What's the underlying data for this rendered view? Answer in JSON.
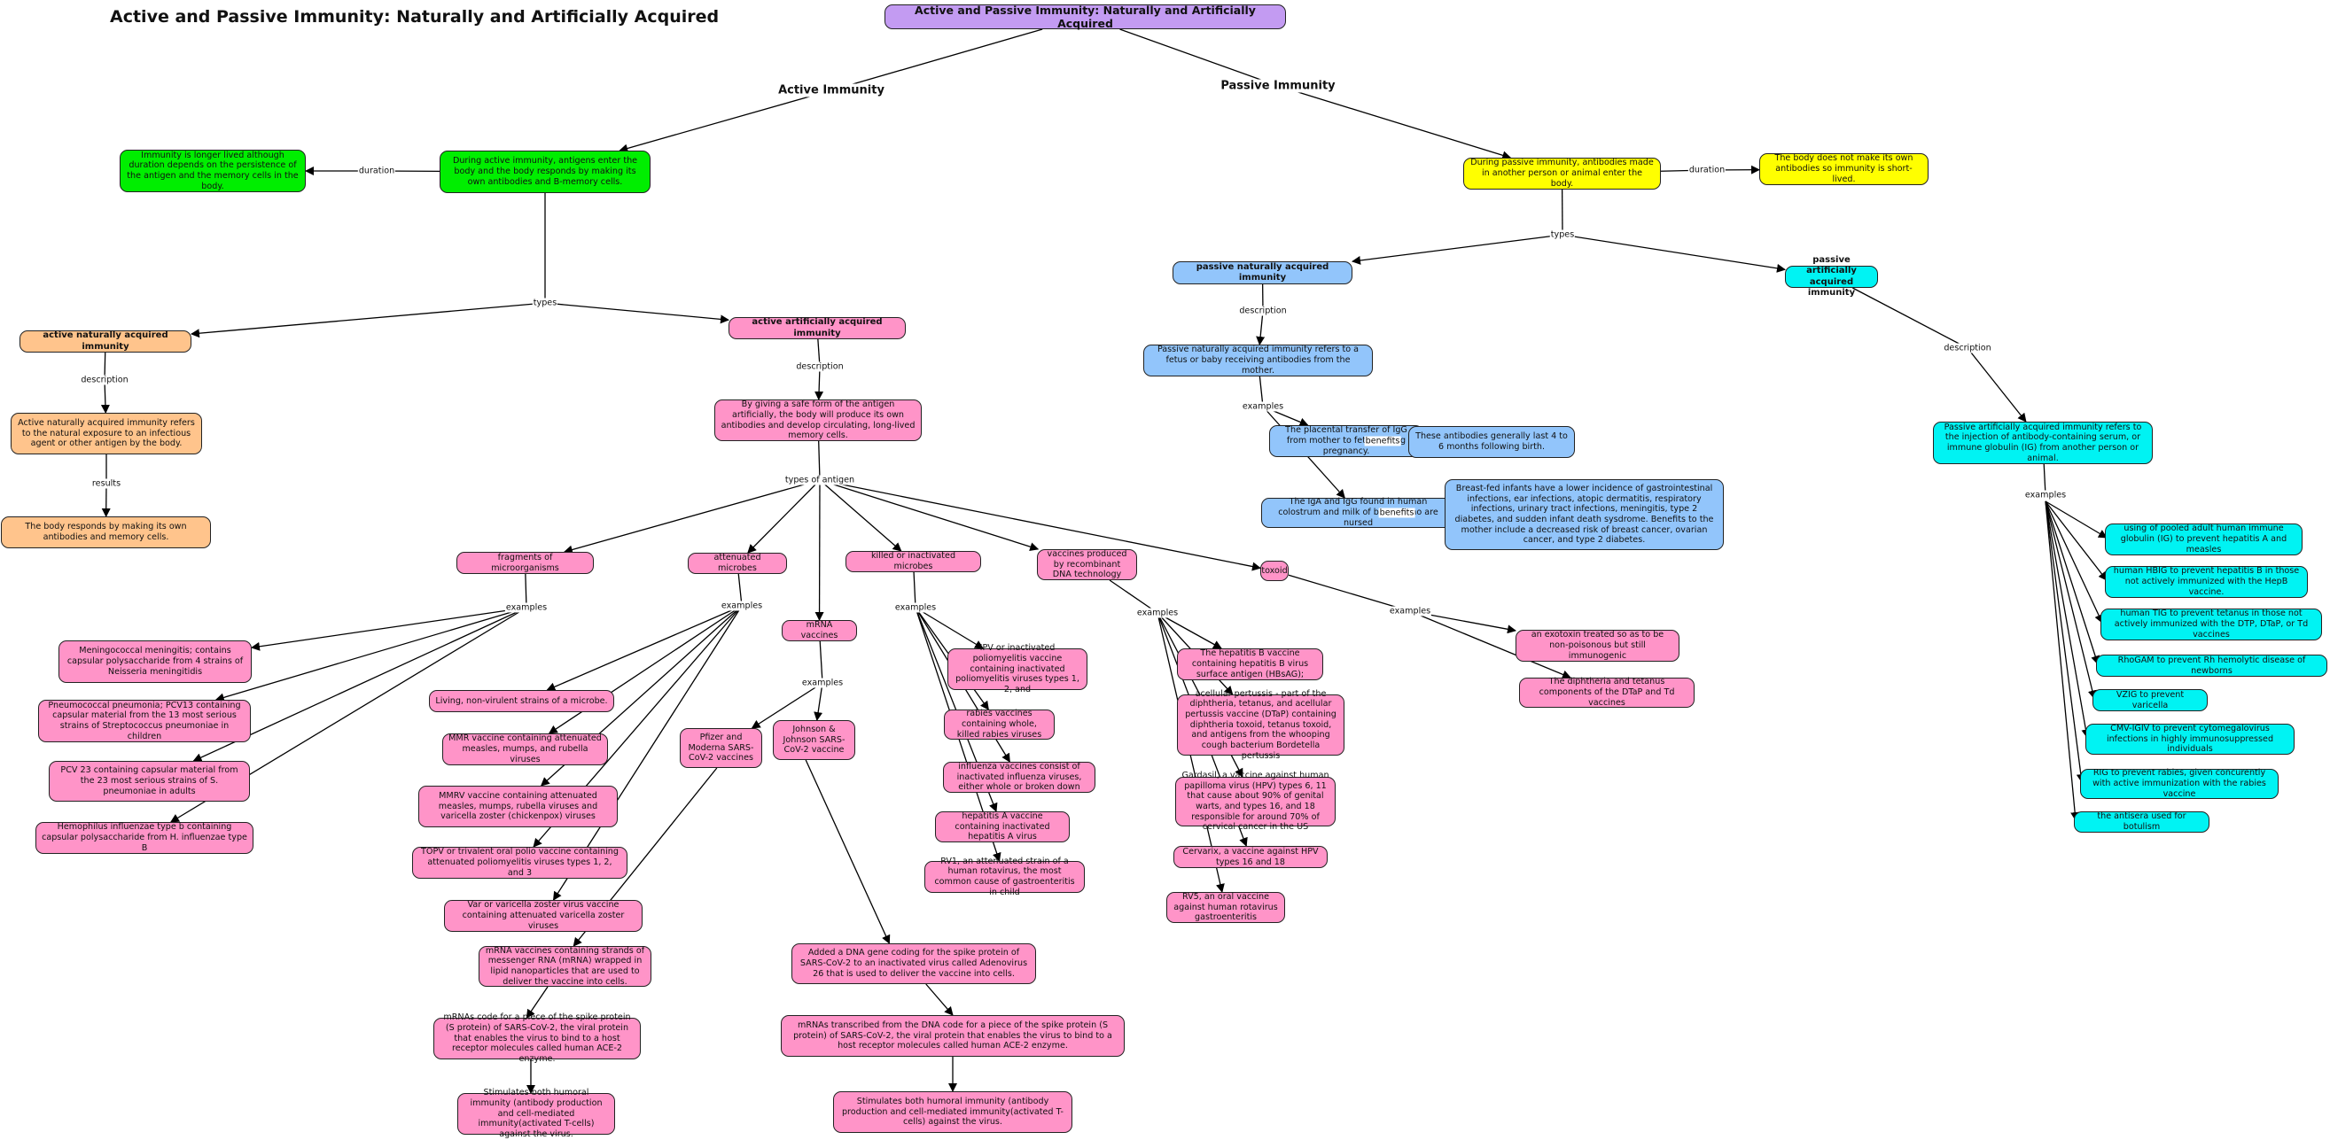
{
  "title": "Active and Passive Immunity: Naturally and Artificially Acquired",
  "colors": {
    "root": "#c39bf2",
    "active": "#00ee00",
    "passive": "#ffff00",
    "active_natural": "#ffc48c",
    "active_artificial": "#ff94c8",
    "passive_natural": "#92c5fb",
    "passive_artificial": "#00f3f3"
  },
  "nodes": {
    "root": "Active and Passive Immunity: Naturally and Artificially Acquired",
    "active_desc": "During active immunity, antigens enter the body and the body responds by making its own antibodies and B-memory cells.",
    "active_duration": "Immunity is longer lived although duration depends on the persistence of the antigen and the memory cells in the body.",
    "passive_desc": "During passive immunity, antibodies made in another person or animal enter the body.",
    "passive_duration": "The body does not make its own antibodies so immunity is short-lived.",
    "active_natural": "active naturally acquired immunity",
    "active_natural_desc": "Active naturally acquired immunity refers to the natural exposure to an infectious agent or other antigen by the body.",
    "active_natural_result": "The body responds by making its own antibodies and memory cells.",
    "active_artificial": "active artificially acquired immunity",
    "active_artificial_desc": "By giving a safe form of the antigen artificially, the body will produce its own antibodies and develop circulating, long-lived memory cells.",
    "fragments": "fragments of microorganisms",
    "frag_1": "Meningococcal meningitis; contains capsular polysaccharide from 4 strains of Neisseria meningitidis",
    "frag_2": "Pneumococcal pneumonia; PCV13 containing capsular material from the 13 most serious strains of Streptococcus pneumoniae in children",
    "frag_3": "PCV 23 containing capsular material from the 23 most serious strains of S. pneumoniae in adults",
    "frag_4": "Hemophilus influenzae type b containing capsular polysaccharide from H. influenzae type B",
    "attenuated": "attenuated microbes",
    "att_1": "Living, non-virulent strains of a microbe.",
    "att_2": "MMR vaccine containing attenuated measles, mumps, and rubella viruses",
    "att_3": "MMRV vaccine containing attenuated measles, mumps, rubella viruses and varicella zoster (chickenpox) viruses",
    "att_4": "TOPV or trivalent oral polio vaccine containing attenuated poliomyelitis viruses types 1, 2, and 3",
    "att_5": "Var or varicella zoster virus vaccine containing attenuated varicella zoster viruses",
    "mrna": "mRNA vaccines",
    "pfizer": "Pfizer and Moderna SARS-CoV-2 vaccines",
    "jj": "Johnson & Johnson SARS-CoV-2 vaccine",
    "pfizer_1": "mRNA vaccines containing strands of messenger RNA (mRNA) wrapped in lipid nanoparticles that are used to deliver the vaccine into cells.",
    "pfizer_2": "mRNAs code for a piece of the spike protein (S protein) of SARS-CoV-2, the viral protein that enables the virus to bind to a host receptor molecules called human ACE-2 enzyme.",
    "pfizer_3": "Stimulates both humoral immunity (antibody production and cell-mediated immunity(activated T-cells) against the virus.",
    "jj_1": "Added a DNA gene coding for the spike protein of SARS-CoV-2 to an inactivated virus called Adenovirus 26 that is used to deliver the vaccine into cells.",
    "jj_2": "mRNAs transcribed from the DNA code for a piece of the spike protein (S protein) of SARS-CoV-2, the viral protein that enables the virus to bind to a host receptor molecules called human ACE-2 enzyme.",
    "jj_3": "Stimulates both humoral immunity (antibody production and cell-mediated immunity(activated T-cells) against the virus.",
    "killed": "killed or inactivated microbes",
    "kill_1": "IPV or inactivated poliomyelitis vaccine containing inactivated poliomyelitis viruses types 1, 2, and",
    "kill_2": "rabies vaccines containing whole, killed rabies viruses",
    "kill_3": "influenza vaccines consist of inactivated influenza viruses, either whole or broken down",
    "kill_4": "hepatitis A vaccine containing inactivated hepatitis A virus",
    "kill_5": "RV1, an attenuated strain of a human rotavirus, the most common cause of gastroenteritis in child",
    "recombinant": "vaccines produced by recombinant DNA technology",
    "rec_1": "The hepatitis B vaccine containing hepatitis B virus surface antigen (HBsAG);",
    "rec_2": "acellular pertussis - part of the diphtheria, tetanus, and acellular pertussis vaccine (DTaP) containing diphtheria toxoid, tetanus toxoid, and antigens from the whooping cough bacterium Bordetella pertussis",
    "rec_3": "Gardasil, a vaccine against human papilloma virus (HPV) types 6, 11 that cause about 90% of genital warts, and types 16, and 18 responsible for around 70% of cervical cancer in the US",
    "rec_4": "Cervarix, a vaccine against HPV types 16 and 18",
    "rec_5": "RV5, an oral vaccine against human rotavirus gastroenteritis",
    "toxoid": "toxoid",
    "tox_1": "an exotoxin treated so as to be non-poisonous but still immunogenic",
    "tox_2": "The diphtheria and tetanus components of the DTaP and Td vaccines",
    "passive_natural": "passive naturally acquired immunity",
    "passive_natural_desc": "Passive naturally acquired immunity refers to a fetus or baby receiving antibodies from the mother.",
    "pn_ex1": "The placental transfer of IgG from mother to fetus during pregnancy.",
    "pn_ben1": "These antibodies generally last 4 to 6 months following birth.",
    "pn_ex2": "The IgA and IgG found in human colostrum and milk of babies who are nursed",
    "pn_ben2": "Breast-fed infants have a lower incidence of gastrointestinal infections, ear infections, atopic dermatitis, respiratory infections, urinary tract infections, meningitis, type 2 diabetes, and sudden infant death sysdrome. Benefits to the mother include a decreased risk of breast cancer, ovarian cancer, and type 2 diabetes.",
    "passive_artificial": "passive artificially acquired immunity",
    "passive_artificial_desc": "Passive artificially acquired immunity refers to the injection of antibody-containing serum, or immune globulin (IG) from another person or animal.",
    "pa_1": "using of pooled adult human immune globulin (IG) to prevent hepatitis A and measles",
    "pa_2": "human HBIG to prevent hepatitis B in those not actively immunized with the HepB vaccine.",
    "pa_3": "human TIG to prevent tetanus in those not actively immunized with the DTP, DTaP, or Td vaccines",
    "pa_4": "RhoGAM to prevent Rh hemolytic disease of newborns",
    "pa_5": "VZIG to prevent varicella",
    "pa_6": "CMV-IGIV to prevent cytomegalovirus infections in highly immunosuppressed individuals",
    "pa_7": "RIG to prevent rabies, given concurently with active immunization with the rabies vaccine",
    "pa_8": "the antisera used for botulism"
  },
  "link_labels": {
    "active_immunity": "Active Immunity",
    "passive_immunity": "Passive Immunity",
    "duration": "duration",
    "types": "types",
    "description": "description",
    "results": "results",
    "types_of_antigen": "types of antigen",
    "examples": "examples",
    "benefits": "benefits"
  }
}
